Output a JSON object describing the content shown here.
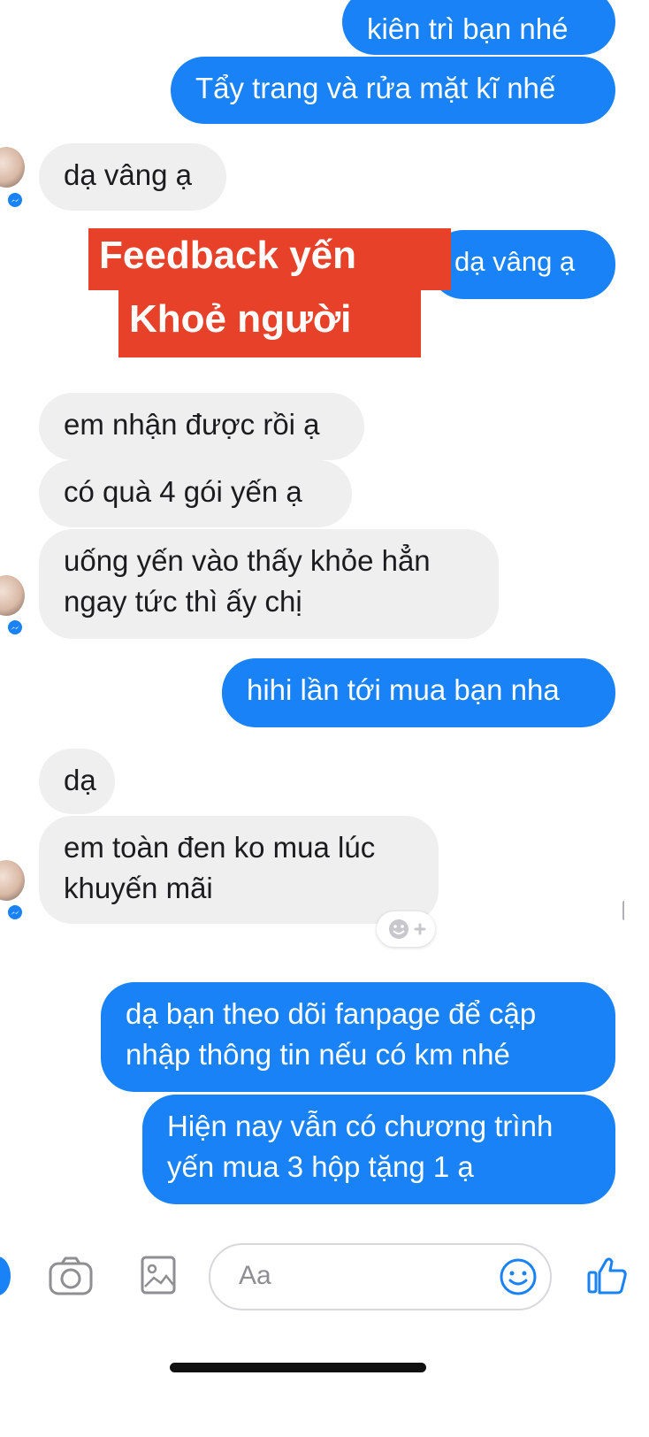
{
  "feedback_label": {
    "line1": "Feedback yến",
    "line2": "Khoẻ người"
  },
  "messages": [
    {
      "direction": "outgoing",
      "text": "kiên trì bạn nhé"
    },
    {
      "direction": "outgoing",
      "text": "Tẩy trang và rửa mặt kĩ nhế"
    },
    {
      "direction": "incoming",
      "text": "dạ vâng ạ"
    },
    {
      "direction": "outgoing",
      "text": "dạ vâng ạ"
    },
    {
      "direction": "incoming",
      "text": "em nhận được rồi ạ"
    },
    {
      "direction": "incoming",
      "text": "có quà 4 gói yến ạ"
    },
    {
      "direction": "incoming",
      "lines": [
        "uống yến vào thấy khỏe hẳn",
        "ngay tức thì ấy chị"
      ]
    },
    {
      "direction": "outgoing",
      "text": "hihi lần tới mua bạn nha"
    },
    {
      "direction": "incoming",
      "text": "dạ"
    },
    {
      "direction": "incoming",
      "lines": [
        "em toàn đen ko mua lúc",
        "khuyến mãi"
      ]
    },
    {
      "direction": "outgoing",
      "lines": [
        "dạ bạn theo dõi fanpage để cập",
        "nhập thông tin nếu có km nhé"
      ]
    },
    {
      "direction": "outgoing",
      "lines": [
        "Hiện nay vẫn có chương trình",
        "yến mua 3 hộp tặng 1 ạ"
      ]
    }
  ],
  "composer": {
    "placeholder": "Aa",
    "icons": [
      "camera-icon",
      "image-icon",
      "emoji-icon",
      "like-icon"
    ]
  },
  "colors": {
    "outgoing_bubble": "#1a82f7",
    "incoming_bubble": "#efeff0",
    "feedback_label": "#e8412a"
  }
}
